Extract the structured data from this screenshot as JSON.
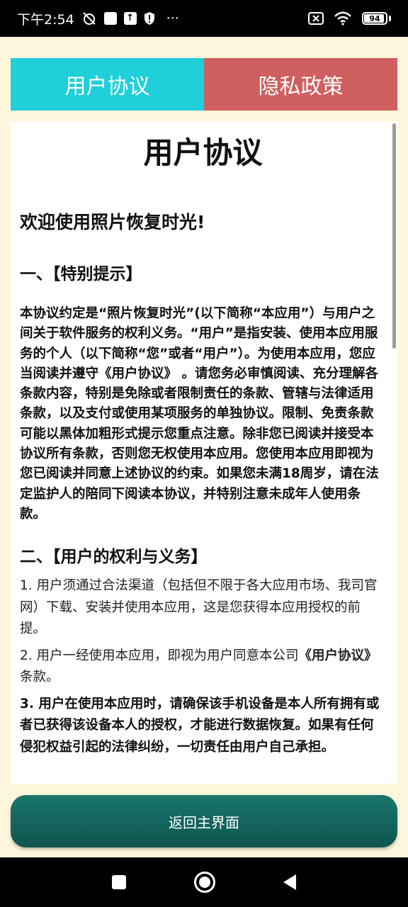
{
  "status_bar": {
    "time": "下午2:54",
    "more": "···",
    "battery_level": "94",
    "battery_fraction": 0.94
  },
  "tabs": [
    {
      "label": "用户协议",
      "color": "#1fcfda",
      "active": true
    },
    {
      "label": "隐私政策",
      "color": "#d05f5f",
      "active": false
    }
  ],
  "document": {
    "title": "用户协议",
    "welcome": "欢迎使用照片恢复时光!",
    "section1": {
      "heading": "一、【特别提示】",
      "body": "本协议约定是“照片恢复时光”(以下简称“本应用”）与用户之间关于软件服务的权利义务。“用户”是指安装、使用本应用服务的个人（以下简称“您”或者“用户”）。为使用本应用，您应当阅读并遵守《用户协议》 。请您务必审慎阅读、充分理解各条款内容，特别是免除或者限制责任的条款、管辖与法律适用条款，以及支付或使用某项服务的单独协议。限制、免责条款可能以黑体加粗形式提示您重点注意。除非您已阅读并接受本协议所有条款，否则您无权使用本应用。您使用本应用即视为您已阅读并同意上述协议的约束。如果您未满18周岁，请在法定监护人的陪同下阅读本协议，并特别注意未成年人使用条款。"
    },
    "section2": {
      "heading": "二、【用户的权利与义务】",
      "item1": "1. 用户须通过合法渠道（包括但不限于各大应用市场、我司官网）下载、安装并使用本应用，这是您获得本应用授权的前提。",
      "item2_prefix": "2. 用户一经使用本应用，即视为用户同意本公司",
      "item2_bold": "《用户协议》",
      "item2_suffix": "条款。",
      "item3": "3. 用户在使用本应用时，请确保该手机设备是本人所有拥有或者已获得该设备本人的授权，才能进行数据恢复。如果有任何侵犯权益引起的法律纠纷，一切责任由用户自己承担。"
    }
  },
  "return_button": "返回主界面"
}
